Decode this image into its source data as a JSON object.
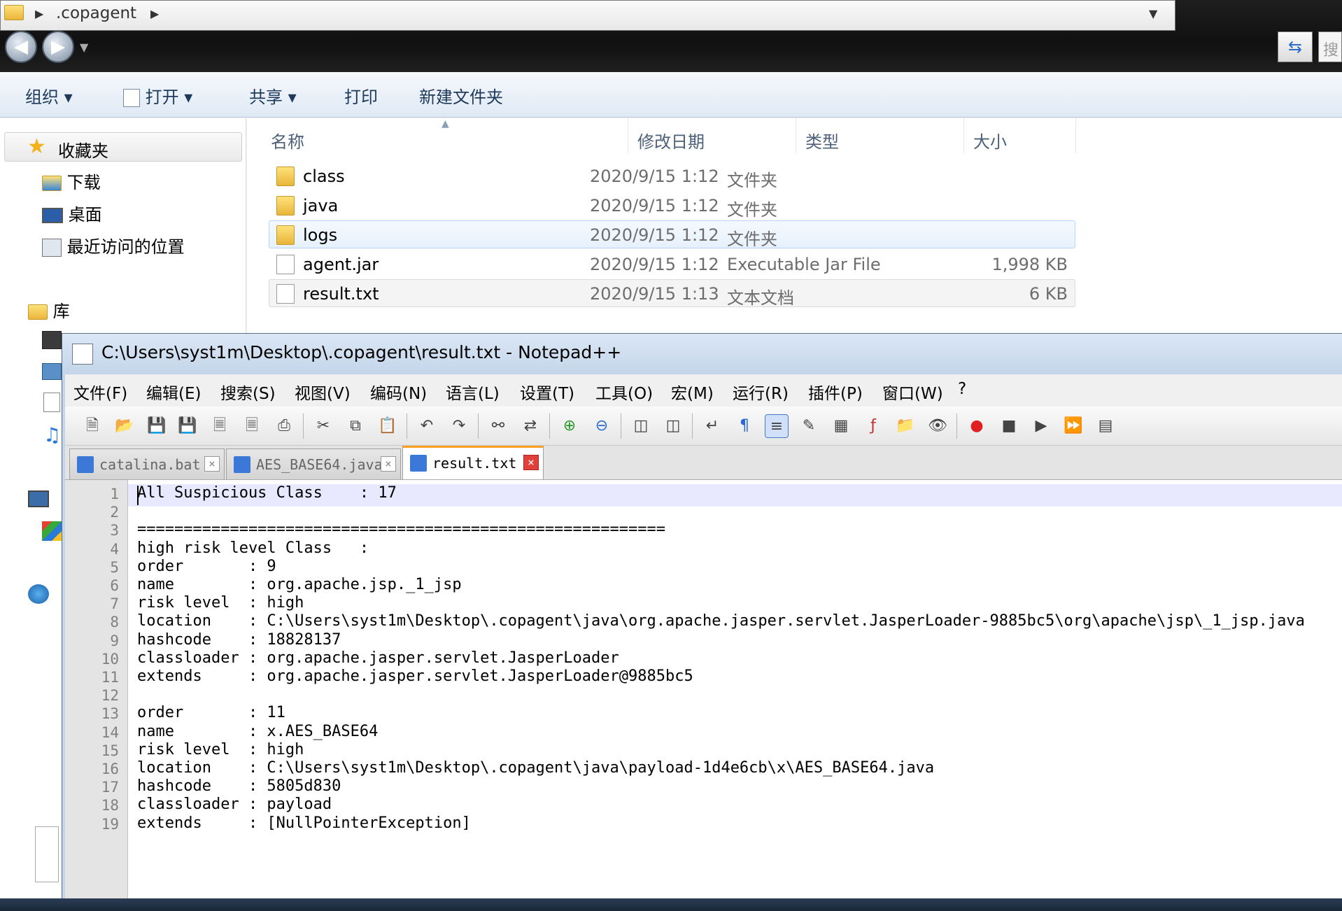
{
  "explorer": {
    "address_segments": [
      ".copagent"
    ],
    "partial_right_text": "搜",
    "toolbar": {
      "organize": "组织",
      "open": "打开",
      "share": "共享",
      "print": "打印",
      "new_folder": "新建文件夹"
    },
    "nav": {
      "favorites": "收藏夹",
      "downloads": "下载",
      "desktop": "桌面",
      "recent": "最近访问的位置",
      "libraries": "库"
    },
    "columns": {
      "name": "名称",
      "modified": "修改日期",
      "type": "类型",
      "size": "大小"
    },
    "files": [
      {
        "name": "class",
        "modified": "2020/9/15 1:12",
        "type": "文件夹",
        "size": "",
        "icon": "folder-icon"
      },
      {
        "name": "java",
        "modified": "2020/9/15 1:12",
        "type": "文件夹",
        "size": "",
        "icon": "folder-icon"
      },
      {
        "name": "logs",
        "modified": "2020/9/15 1:12",
        "type": "文件夹",
        "size": "",
        "icon": "folder-icon"
      },
      {
        "name": "agent.jar",
        "modified": "2020/9/15 1:12",
        "type": "Executable Jar File",
        "size": "1,998 KB",
        "icon": "file-icon"
      },
      {
        "name": "result.txt",
        "modified": "2020/9/15 1:13",
        "type": "文本文档",
        "size": "6 KB",
        "icon": "text-file-icon"
      }
    ]
  },
  "notepad": {
    "title": "C:\\Users\\syst1m\\Desktop\\.copagent\\result.txt - Notepad++",
    "menu": [
      "文件(F)",
      "编辑(E)",
      "搜索(S)",
      "视图(V)",
      "编码(N)",
      "语言(L)",
      "设置(T)",
      "工具(O)",
      "宏(M)",
      "运行(R)",
      "插件(P)",
      "窗口(W)",
      "?"
    ],
    "tabs": [
      {
        "label": "catalina.bat",
        "active": false
      },
      {
        "label": "AES_BASE64.java",
        "active": false
      },
      {
        "label": "result.txt",
        "active": true
      }
    ],
    "lines": [
      "All Suspicious Class    : 17",
      "",
      "=========================================================",
      "high risk level Class   :",
      "order       : 9",
      "name        : org.apache.jsp._1_jsp",
      "risk level  : high",
      "location    : C:\\Users\\syst1m\\Desktop\\.copagent\\java\\org.apache.jasper.servlet.JasperLoader-9885bc5\\org\\apache\\jsp\\_1_jsp.java",
      "hashcode    : 18828137",
      "classloader : org.apache.jasper.servlet.JasperLoader",
      "extends     : org.apache.jasper.servlet.JasperLoader@9885bc5",
      "",
      "order       : 11",
      "name        : x.AES_BASE64",
      "risk level  : high",
      "location    : C:\\Users\\syst1m\\Desktop\\.copagent\\java\\payload-1d4e6cb\\x\\AES_BASE64.java",
      "hashcode    : 5805d830",
      "classloader : payload",
      "extends     : [NullPointerException]"
    ]
  }
}
